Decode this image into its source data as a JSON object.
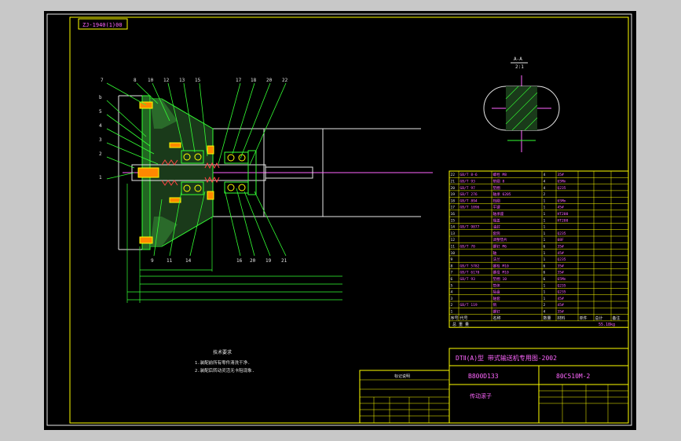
{
  "drawing_number_box": "ZJ-1940(1)00",
  "section_label": {
    "title": "A-A",
    "scale": "2:1"
  },
  "balloons_top": [
    "7",
    "8",
    "10",
    "12",
    "13",
    "15",
    "17",
    "18",
    "20",
    "22"
  ],
  "balloons_left": [
    "b",
    "5",
    "4",
    "3",
    "2",
    "1"
  ],
  "balloons_bottom": [
    "9",
    "11",
    "14",
    "16",
    "20",
    "19",
    "21"
  ],
  "tech_requirements": {
    "title": "技术要求",
    "lines": [
      "1.装配前所有零件清洗干净.",
      "2.装配后转动灵活无卡阻现象."
    ]
  },
  "parts_table": {
    "rows": [
      [
        "22",
        "GB/T 8-6",
        "螺栓 M8",
        "4",
        "35#",
        "",
        "",
        ""
      ],
      [
        "21",
        "GB/T 93",
        "垫圈 8",
        "4",
        "65Mn",
        "",
        "",
        ""
      ],
      [
        "20",
        "GB/T 97",
        "垫圈",
        "4",
        "Q235",
        "",
        "",
        ""
      ],
      [
        "19",
        "GB/T 276",
        "轴承 6205",
        "2",
        "",
        "",
        "",
        ""
      ],
      [
        "18",
        "GB/T 894",
        "挡圈",
        "1",
        "65Mn",
        "",
        "",
        ""
      ],
      [
        "17",
        "GB/T 1096",
        "平键",
        "1",
        "45#",
        "",
        "",
        ""
      ],
      [
        "16",
        "",
        "轴承座",
        "1",
        "HT200",
        "",
        "",
        ""
      ],
      [
        "15",
        "",
        "端盖",
        "1",
        "HT200",
        "",
        "",
        ""
      ],
      [
        "14",
        "GB/T 9877",
        "油封",
        "1",
        "",
        "",
        "",
        ""
      ],
      [
        "13",
        "",
        "套筒",
        "1",
        "Q235",
        "",
        "",
        ""
      ],
      [
        "12",
        "",
        "调整垫片",
        "1",
        "08F",
        "",
        "",
        ""
      ],
      [
        "11",
        "GB/T 70",
        "螺钉 M6",
        "6",
        "35#",
        "",
        "",
        ""
      ],
      [
        "10",
        "",
        "轴",
        "1",
        "45#",
        "",
        "",
        ""
      ],
      [
        "9",
        "",
        "法兰",
        "1",
        "Q235",
        "",
        "",
        ""
      ],
      [
        "8",
        "GB/T 5782",
        "螺栓 M10",
        "6",
        "35#",
        "",
        "",
        ""
      ],
      [
        "7",
        "GB/T 6170",
        "螺母 M10",
        "6",
        "35#",
        "",
        "",
        ""
      ],
      [
        "6",
        "GB/T 93",
        "垫圈 10",
        "6",
        "65Mn",
        "",
        "",
        ""
      ],
      [
        "5",
        "",
        "筒体",
        "1",
        "Q235",
        "",
        "",
        ""
      ],
      [
        "4",
        "",
        "接盘",
        "1",
        "Q235",
        "",
        "",
        ""
      ],
      [
        "3",
        "",
        "轴套",
        "1",
        "45#",
        "",
        "",
        ""
      ],
      [
        "2",
        "GB/T 119",
        "销",
        "2",
        "45#",
        "",
        "",
        ""
      ],
      [
        "1",
        "",
        "螺钉",
        "4",
        "35#",
        "",
        "",
        ""
      ]
    ],
    "header": [
      "序号",
      "代号",
      "名称",
      "数量",
      "材料",
      "单件",
      "总计",
      "备注"
    ],
    "subheader_left": "总 重 量",
    "subheader_right": "55.18kg"
  },
  "title_block": {
    "project": "DTⅡ(A)型 带式输送机专用图-2002",
    "code_left": "B800D133",
    "code_right": "80C510M-2",
    "name": "传动滚子",
    "notes_title": "标记说明"
  }
}
